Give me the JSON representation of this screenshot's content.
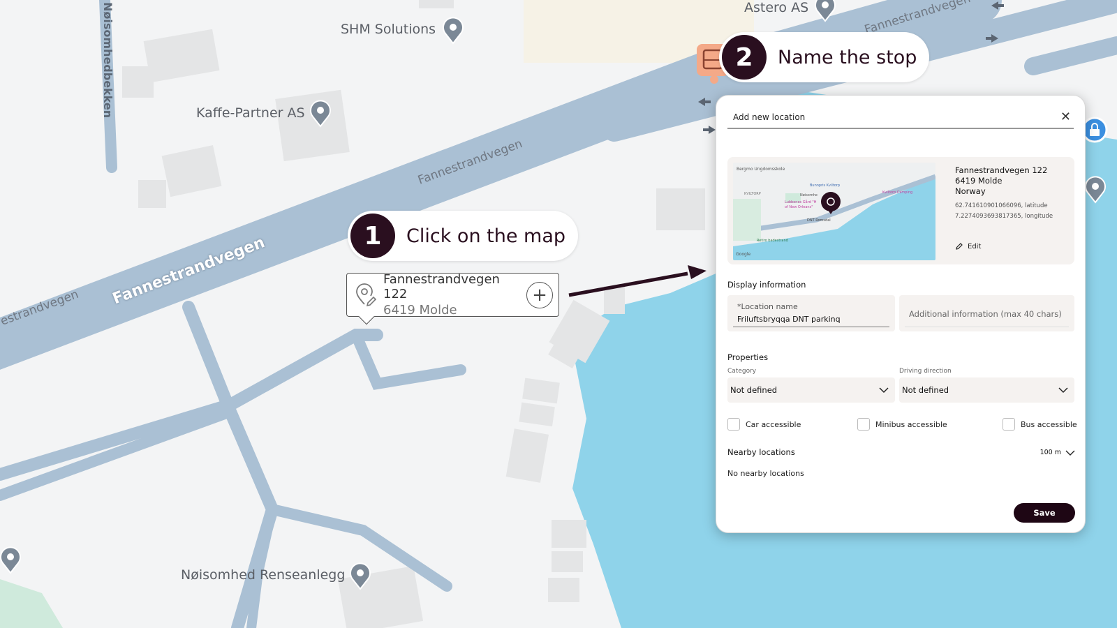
{
  "map": {
    "places": {
      "astero": "Astero AS",
      "shm": "SHM Solutions",
      "kaffe": "Kaffe-Partner AS",
      "renseanlegg": "Nøisomhed Renseanlegg"
    },
    "roads": {
      "fannestrand_main": "Fannestrandvegen",
      "fannestrand_mid": "Fannestrandvegen",
      "fannestrand_top": "Fannestrandvegen",
      "fannestrand_left": "estrandvegen",
      "noisomhedbekken": "Nøisomhedbekken"
    }
  },
  "steps": {
    "step1": {
      "number": "1",
      "text": "Click on the map"
    },
    "step2": {
      "number": "2",
      "text": "Name the stop"
    }
  },
  "popup": {
    "street": "Fannestrandvegen 122",
    "postal": "6419 Molde",
    "add_icon": "plus-circle-icon"
  },
  "dialog": {
    "title": "Add new location",
    "close": "✕",
    "address": {
      "street": "Fannestrandvegen 122",
      "postal": "6419 Molde",
      "country": "Norway",
      "latitude": "62.741610901066096, latitude",
      "longitude": "7.2274093693817365, longitude",
      "edit_label": "Edit"
    },
    "mini_map": {
      "labels": {
        "school": "Bergmo Ungdomsskole",
        "kviltorp": "KVILTORP",
        "bunnpris": "Bunnpris Kviltorp",
        "kviltorp_camping": "Kviltorp Camping",
        "noisomhe": "Nøisomhe",
        "lubbenes": "Lubbenes Gård \"H",
        "new_orleans": "of New Orleans\"",
        "dnt": "DNT Romsdal",
        "retiro": "Retiro badestrand",
        "google": "Google"
      }
    },
    "display_info": {
      "heading": "Display information",
      "location_name_label": "*Location name",
      "location_name_value": "Friluftsbryqqa DNT parkinq",
      "additional_placeholder": "Additional information (max 40 chars)"
    },
    "properties": {
      "heading": "Properties",
      "category_label": "Category",
      "category_value": "Not defined",
      "direction_label": "Driving direction",
      "direction_value": "Not defined",
      "checkboxes": [
        {
          "label": "Car accessible",
          "checked": false
        },
        {
          "label": "Minibus accessible",
          "checked": false
        },
        {
          "label": "Bus accessible",
          "checked": false
        }
      ]
    },
    "nearby": {
      "heading": "Nearby locations",
      "radius": "100 m",
      "empty_text": "No nearby locations"
    },
    "save_label": "Save"
  },
  "colors": {
    "water": "#8fd3ea",
    "road": "#aac0d4",
    "land": "#f3f4f5",
    "building": "#e4e5e6",
    "accent_dark": "#2a0f1f",
    "pin": "#7b8896",
    "bus_stop": "#f4a988",
    "lock_pin": "#3b8fe0"
  }
}
